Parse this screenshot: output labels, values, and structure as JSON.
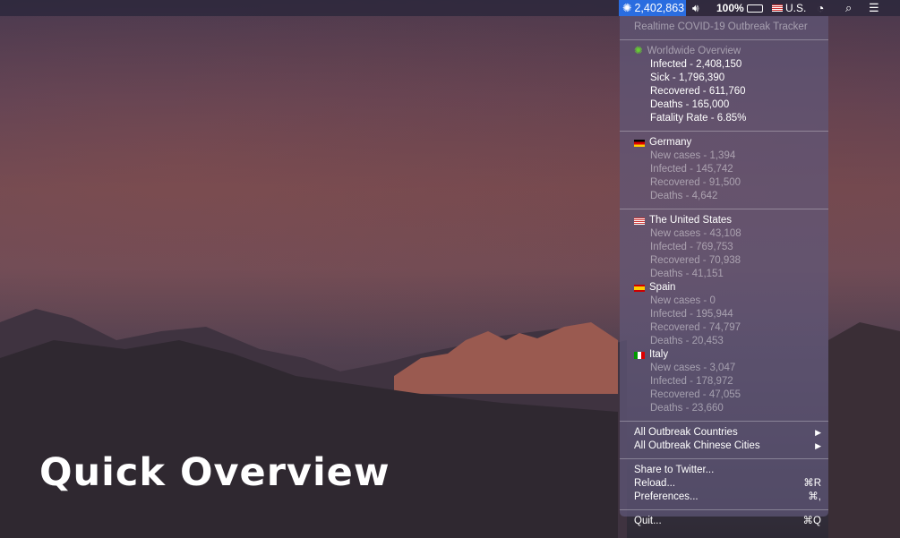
{
  "menubar": {
    "counter": "2,402,863",
    "battery": "100%",
    "input_source": "U.S.",
    "icons": [
      "virus-icon",
      "volume-icon",
      "battery-icon",
      "flag-us-icon",
      "clock-icon",
      "search-icon",
      "list-icon"
    ]
  },
  "menu": {
    "title": "Realtime COVID-19 Outbreak Tracker",
    "worldwide": {
      "header": "Worldwide Overview",
      "lines": [
        "Infected - 2,408,150",
        "Sick - 1,796,390",
        "Recovered - 611,760",
        "Deaths - 165,000",
        "Fatality Rate - 6.85%"
      ]
    },
    "countries": [
      {
        "name": "Germany",
        "flag": "de",
        "lines": [
          "New cases - 1,394",
          "Infected - 145,742",
          "Recovered - 91,500",
          "Deaths - 4,642"
        ]
      },
      {
        "name": "The United States",
        "flag": "us",
        "lines": [
          "New cases - 43,108",
          "Infected - 769,753",
          "Recovered - 70,938",
          "Deaths - 41,151"
        ]
      },
      {
        "name": "Spain",
        "flag": "es",
        "lines": [
          "New cases - 0",
          "Infected - 195,944",
          "Recovered - 74,797",
          "Deaths - 20,453"
        ]
      },
      {
        "name": "Italy",
        "flag": "it",
        "lines": [
          "New cases - 3,047",
          "Infected - 178,972",
          "Recovered - 47,055",
          "Deaths - 23,660"
        ]
      }
    ],
    "submenus": [
      {
        "label": "All Outbreak Countries",
        "arrow": "▶"
      },
      {
        "label": "All Outbreak Chinese Cities",
        "arrow": "▶"
      }
    ],
    "actions": [
      {
        "label": "Share to Twitter...",
        "shortcut": ""
      },
      {
        "label": "Reload...",
        "shortcut": "⌘R"
      },
      {
        "label": "Preferences...",
        "shortcut": "⌘,"
      }
    ],
    "quit": {
      "label": "Quit...",
      "shortcut": "⌘Q"
    }
  },
  "overlay_title": "Quick Overview"
}
